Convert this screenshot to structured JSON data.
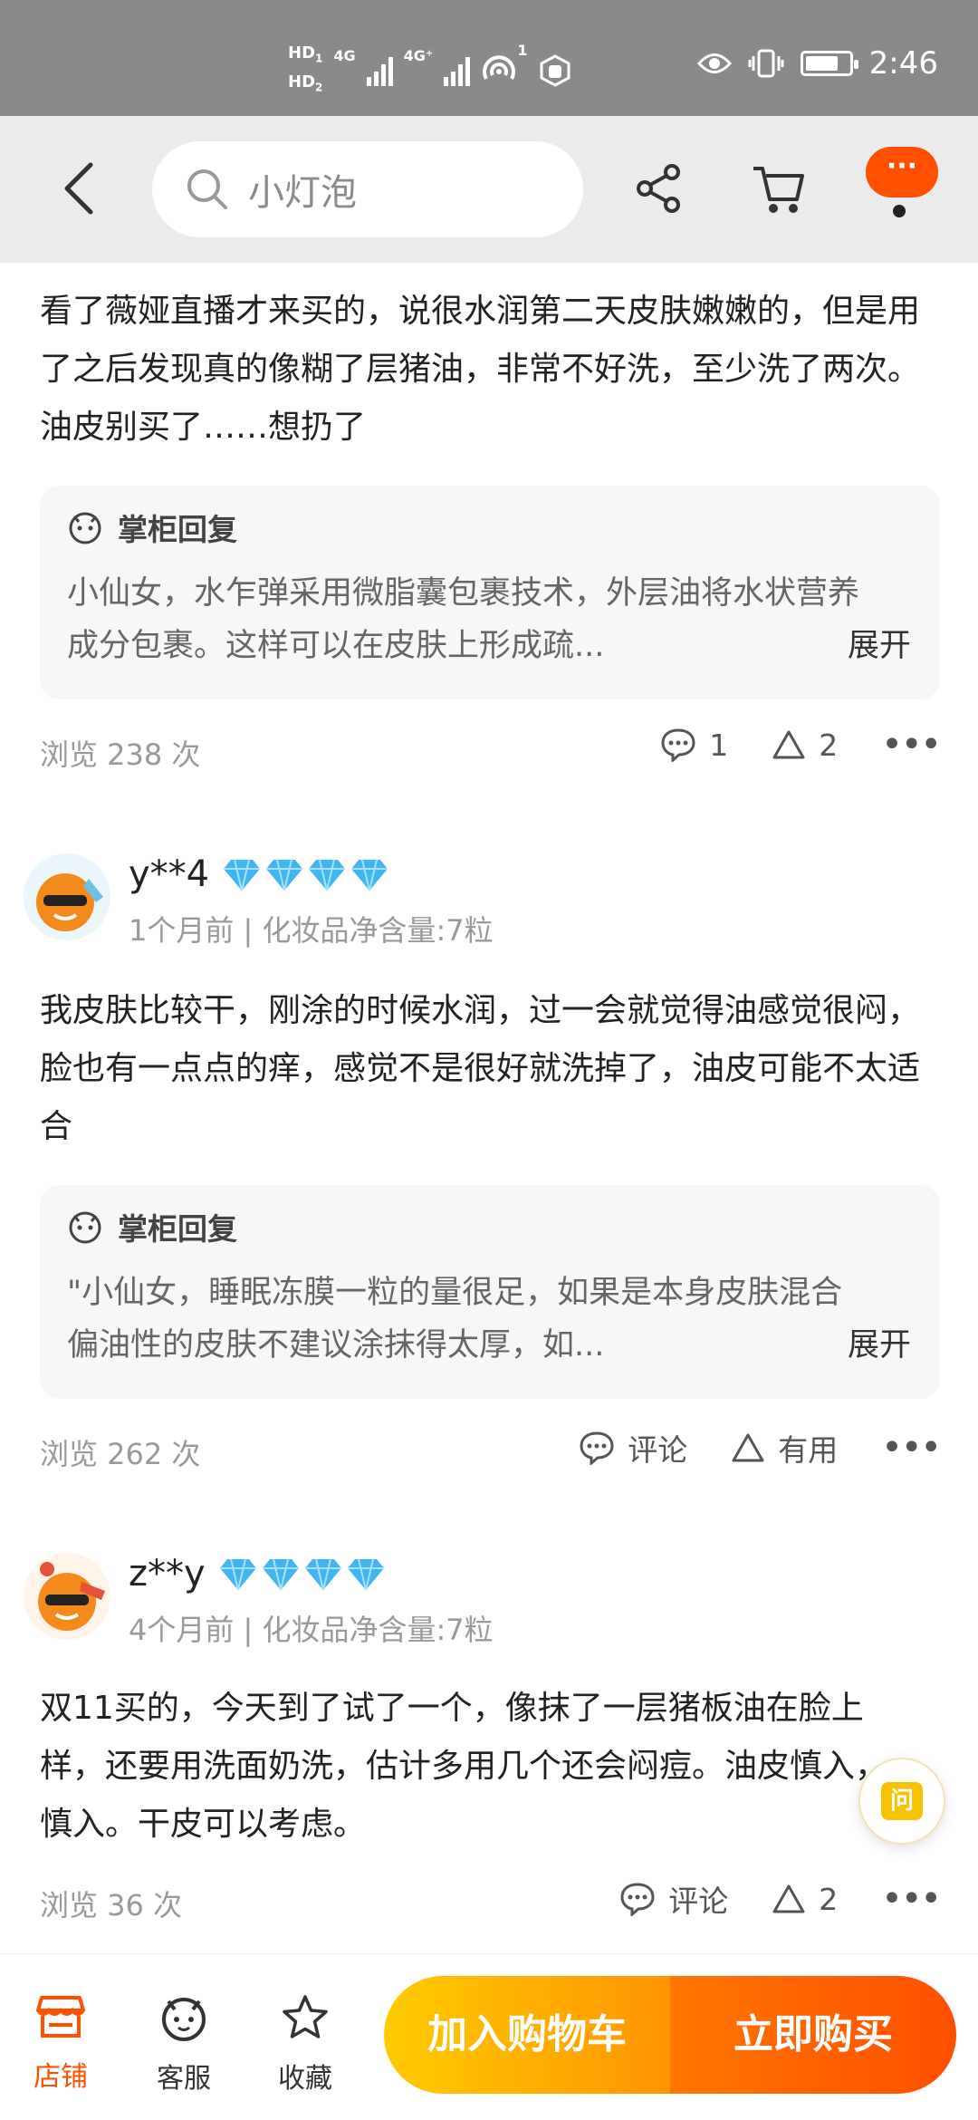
{
  "status_bar": {
    "hd1": "HD",
    "hd1_sub": "1",
    "hd2": "HD",
    "hd2_sub": "2",
    "net1": "4G",
    "net2": "4G⁺",
    "hotspot_count": "1",
    "time": "2:46",
    "battery_level": 0.75
  },
  "header": {
    "search_placeholder": "小灯泡",
    "more_label": "···"
  },
  "reviews": [
    {
      "text": "看了薇娅直播才来买的，说很水润第二天皮肤嫩嫩的，但是用了之后发现真的像糊了层猪油，非常不好洗，至少洗了两次。油皮别买了……想扔了",
      "reply": {
        "title": "掌柜回复",
        "body": "小仙女，水乍弹采用微脂囊包裹技术，外层油将水状营养成分包裹。这样可以在皮肤上形成疏...",
        "expand": "展开"
      },
      "views": "浏览 238 次",
      "comment": "1",
      "useful": "2"
    },
    {
      "user": "y**4",
      "meta": "1个月前 | 化妆品净含量:7粒",
      "text": "我皮肤比较干，刚涂的时候水润，过一会就觉得油感觉很闷，脸也有一点点的痒，感觉不是很好就洗掉了，油皮可能不太适合",
      "reply": {
        "title": "掌柜回复",
        "body": "\"小仙女，睡眠冻膜一粒的量很足，如果是本身皮肤混合偏油性的皮肤不建议涂抹得太厚，如...",
        "expand": "展开"
      },
      "views": "浏览 262 次",
      "comment": "评论",
      "useful": "有用"
    },
    {
      "user": "z**y",
      "meta": "4个月前 | 化妆品净含量:7粒",
      "text": "双11买的，今天到了试了一个，像抹了一层猪板油在脸上样，还要用洗面奶洗，估计多用几个还会闷痘。油皮慎入，慎入。干皮可以考虑。",
      "views": "浏览 36 次",
      "comment": "评论",
      "useful": "2"
    }
  ],
  "ask_float": "问",
  "bottom_bar": {
    "shop": "店铺",
    "service": "客服",
    "favorite": "收藏",
    "add_to_cart": "加入购物车",
    "buy_now": "立即购买"
  },
  "colors": {
    "accent": "#ff5000",
    "diamond": "#3fb6f2",
    "cart_gradient": [
      "#ffcb00",
      "#ff9402"
    ],
    "buy_gradient": [
      "#ff7700",
      "#ff4e00"
    ]
  }
}
